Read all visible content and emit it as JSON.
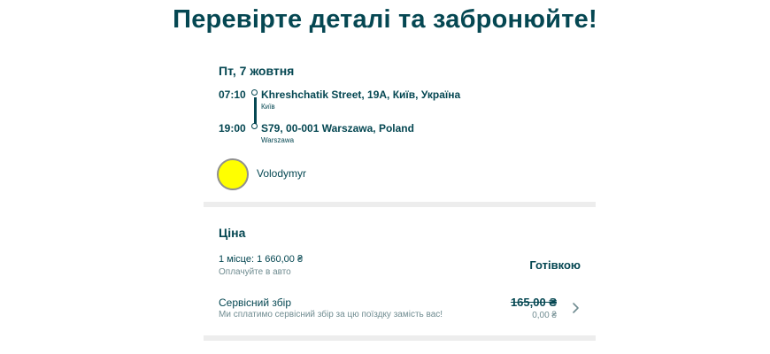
{
  "page": {
    "title": "Перевірте деталі та забронюйте!"
  },
  "trip": {
    "date": "Пт, 7 жовтня",
    "departure": {
      "time": "07:10",
      "address": "Khreshchatik Street, 19A, Київ, Україна",
      "city": "Київ"
    },
    "arrival": {
      "time": "19:00",
      "address": "S79, 00-001 Warszawa, Poland",
      "city": "Warszawa"
    }
  },
  "driver": {
    "name": "Volodymyr",
    "avatar_color": "#ffff00"
  },
  "price": {
    "heading": "Ціна",
    "seat_label": "1 місце: 1 660,00 ₴",
    "seat_sub": "Оплачуйте в авто",
    "payment_method": "Готівкою",
    "fee_label": "Сервісний збір",
    "fee_sub": "Ми сплатимо сервісний збір за цю поїздку замість вас!",
    "fee_old": "165,00 ₴",
    "fee_new": "0,00 ₴"
  },
  "icons": {
    "fee_chevron": "chevron-right-icon"
  },
  "colors": {
    "primary": "#054752",
    "muted": "#708c91",
    "divider": "#ededed"
  }
}
